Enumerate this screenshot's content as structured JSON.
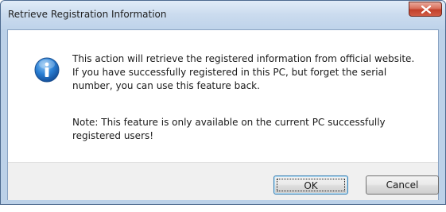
{
  "window": {
    "title": "Retrieve Registration Information",
    "close_icon": "close-x-icon"
  },
  "message": {
    "icon": "info-icon",
    "paragraph1": "This action will retrieve the registered information from official website.\nIf you have successfully registered in this PC, but forget the serial\nnumber, you can use this feature back.",
    "paragraph2": "Note: This feature is only available on the current PC successfully\nregistered users!"
  },
  "buttons": {
    "ok_label": "OK",
    "cancel_label": "Cancel"
  },
  "colors": {
    "titlebar": "#cadbee",
    "close_button": "#c2402b",
    "info_icon": "#1f6fc5",
    "footer": "#f0f0f0"
  }
}
